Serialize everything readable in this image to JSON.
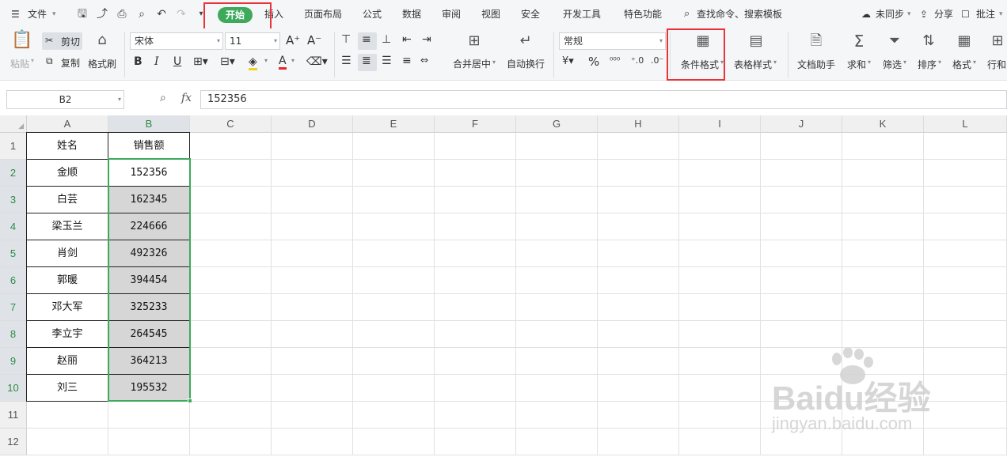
{
  "menubar": {
    "file_label": "文件",
    "tabs": [
      "开始",
      "插入",
      "页面布局",
      "公式",
      "数据",
      "审阅",
      "视图",
      "安全",
      "开发工具",
      "特色功能"
    ],
    "search_label": "查找命令、搜索模板",
    "sync_label": "未同步",
    "share_label": "分享",
    "comment_label": "批注"
  },
  "ribbon": {
    "paste": "粘贴",
    "cut": "剪切",
    "copy": "复制",
    "format_painter": "格式刷",
    "font_name": "宋体",
    "font_size": "11",
    "merge_center": "合并居中",
    "wrap_text": "自动换行",
    "number_format": "常规",
    "conditional_format": "条件格式",
    "table_style": "表格样式",
    "doc_helper": "文档助手",
    "sum": "求和",
    "filter": "筛选",
    "sort": "排序",
    "format": "格式",
    "row_col": "行和"
  },
  "formula_bar": {
    "name_box": "B2",
    "fx_label": "fx",
    "formula": "152356"
  },
  "columns": [
    "A",
    "B",
    "C",
    "D",
    "E",
    "F",
    "G",
    "H",
    "I",
    "J",
    "K",
    "L"
  ],
  "rows": [
    "1",
    "2",
    "3",
    "4",
    "5",
    "6",
    "7",
    "8",
    "9",
    "10",
    "11",
    "12"
  ],
  "table": {
    "headers": [
      "姓名",
      "销售额"
    ],
    "data": [
      [
        "金顺",
        "152356"
      ],
      [
        "白芸",
        "162345"
      ],
      [
        "梁玉兰",
        "224666"
      ],
      [
        "肖剑",
        "492326"
      ],
      [
        "郭暖",
        "394454"
      ],
      [
        "邓大军",
        "325233"
      ],
      [
        "李立宇",
        "264545"
      ],
      [
        "赵丽",
        "364213"
      ],
      [
        "刘三",
        "195532"
      ]
    ]
  },
  "watermark": {
    "brand": "Baidu经验",
    "url": "jingyan.baidu.com"
  },
  "colors": {
    "accent": "#3daa5b",
    "highlight_box": "#e8323c",
    "selection_fill": "#d6d6d6"
  }
}
